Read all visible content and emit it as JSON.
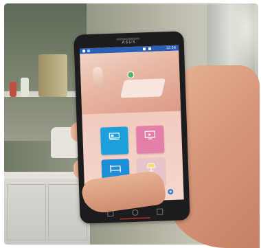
{
  "phone": {
    "brand": "ASUS",
    "status_time": "12:36"
  },
  "app": {
    "title": "",
    "subtitle": "",
    "tiles": [
      {
        "label": "",
        "icon": "bed-icon",
        "color": "#1ea0dc"
      },
      {
        "label": "",
        "icon": "monitor-icon",
        "color": "#e37fa8"
      },
      {
        "label": "",
        "icon": "bed-icon",
        "color": "#1c8fd6"
      },
      {
        "label": "",
        "icon": "lamp-icon",
        "color": "#e6c4c9"
      }
    ],
    "colors": {
      "statusbar": "#2b5fb5",
      "screen_background": "#f1c9bd",
      "mic": "#2b7fd6"
    }
  }
}
